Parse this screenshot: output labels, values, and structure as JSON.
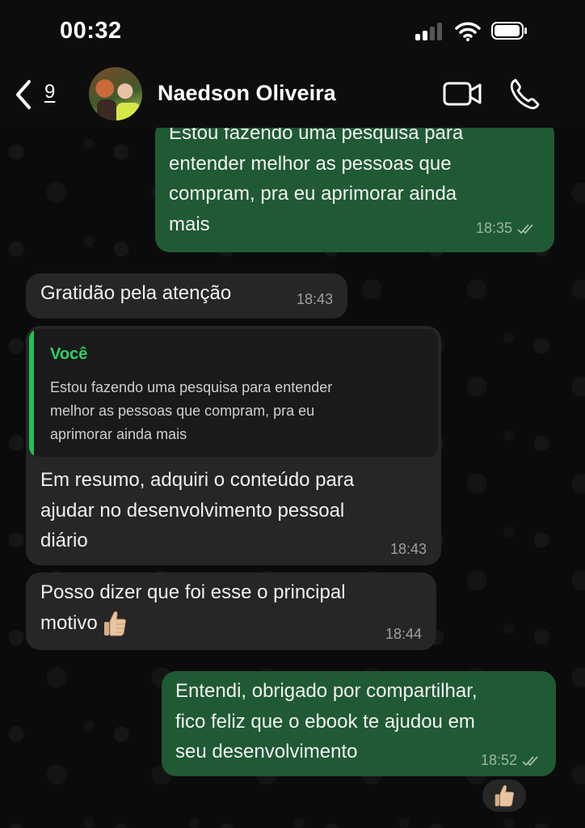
{
  "status_bar": {
    "time": "00:32"
  },
  "header": {
    "back_count": "9",
    "contact_name": "Naedson Oliveira"
  },
  "messages": [
    {
      "direction": "outgoing",
      "text": "Estou fazendo uma pesquisa para\nentender melhor as pessoas que\ncompram, pra eu aprimorar ainda\nmais",
      "time": "18:35",
      "status": "read"
    },
    {
      "direction": "incoming",
      "text": "Gratidão pela atenção",
      "time": "18:43"
    },
    {
      "direction": "incoming",
      "quote_author": "Você",
      "quote_text": "Estou fazendo uma pesquisa para entender\nmelhor as pessoas que compram, pra eu\naprimorar ainda mais",
      "text": "Em resumo, adquiri o conteúdo para\najudar no desenvolvimento pessoal\ndiário",
      "time": "18:43"
    },
    {
      "direction": "incoming",
      "text": "Posso dizer que foi esse o  principal\nmotivo",
      "emoji": "thumbs-up",
      "time": "18:44"
    },
    {
      "direction": "outgoing",
      "text": "Entendi, obrigado por compartilhar,\nfico feliz que o ebook te ajudou em\nseu desenvolvimento",
      "time": "18:52",
      "status": "read",
      "reaction": "thumbs-up"
    }
  ],
  "colors": {
    "outgoing_bubble": "#1f5a34",
    "incoming_bubble": "#262626",
    "quote_accent": "#25c05a",
    "background": "#0b0b0b"
  },
  "icons": [
    "back-chevron-icon",
    "video-call-icon",
    "phone-call-icon",
    "read-ticks-icon",
    "thumbs-up-icon",
    "wifi-icon",
    "battery-icon",
    "signal-icon"
  ]
}
